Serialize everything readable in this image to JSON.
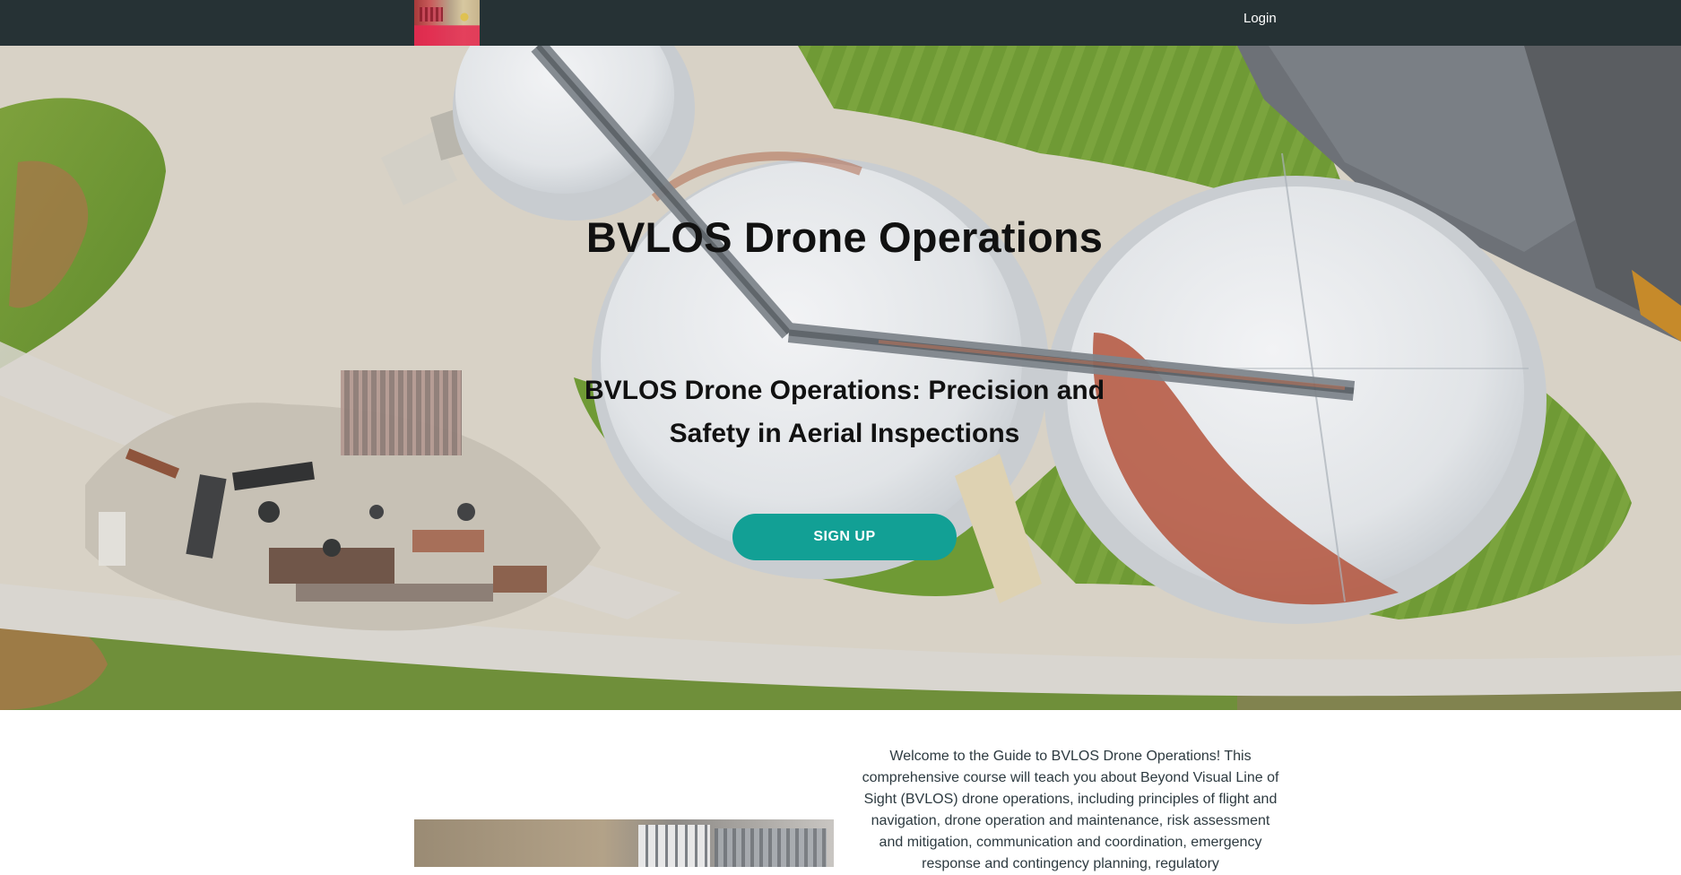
{
  "nav": {
    "login_label": "Login"
  },
  "hero": {
    "title": "BVLOS Drone Operations",
    "subtitle": "BVLOS Drone Operations: Precision and Safety in Aerial Inspections",
    "cta_label": "SIGN UP"
  },
  "intro": {
    "text": "Welcome to the Guide to BVLOS Drone Operations! This comprehensive course will teach you about Beyond Visual Line of Sight (BVLOS) drone operations, including principles of flight and navigation, drone operation and maintenance, risk assessment and mitigation, communication and coordination, emergency response and contingency planning, regulatory"
  },
  "colors": {
    "nav_background": "#263235",
    "cta_background": "#12a095",
    "cta_text": "#ffffff"
  }
}
